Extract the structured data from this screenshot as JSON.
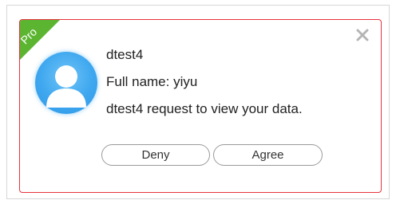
{
  "badge": {
    "label": "Pro",
    "color": "#5cb531"
  },
  "close": {
    "icon": "close-icon",
    "glyph": "X"
  },
  "user": {
    "username": "dtest4",
    "full_name_label": "Full name:",
    "full_name": "yiyu",
    "request_message": "dtest4 request to view your data."
  },
  "actions": {
    "deny_label": "Deny",
    "agree_label": "Agree"
  },
  "colors": {
    "dialog_border": "#e8323c",
    "avatar_blue": "#3ea7ef"
  }
}
